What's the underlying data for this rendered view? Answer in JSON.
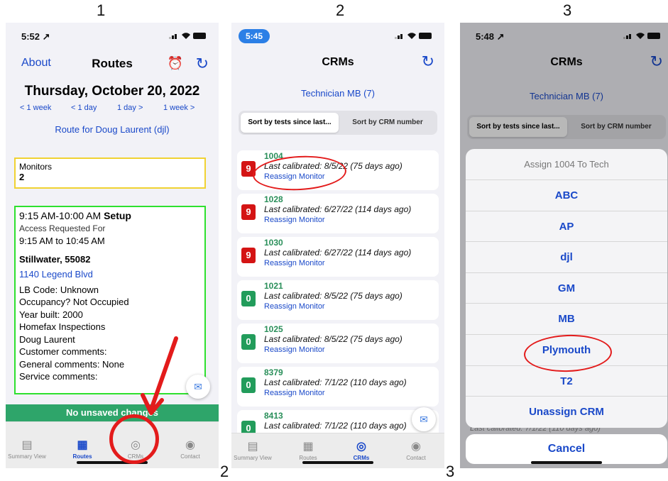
{
  "panel_numbers": [
    "1",
    "2",
    "3"
  ],
  "bottom_labels": [
    "2",
    "3"
  ],
  "colors": {
    "accent": "#1a49c9",
    "green_bar": "#2ea56a",
    "red_badge": "#d41414",
    "green_badge": "#229c5b",
    "annotation_red": "#e31b1b"
  },
  "panel1": {
    "status_time": "5:52 ↗",
    "nav": {
      "about": "About",
      "title": "Routes",
      "alarm_icon": "⏰",
      "refresh_icon": "↻"
    },
    "date": "Thursday, October 20, 2022",
    "nudges": [
      "< 1 week",
      "< 1 day",
      "1 day >",
      "1 week >"
    ],
    "route": "Route for Doug Laurent (djl)",
    "monitors": {
      "label": "Monitors",
      "value": "2"
    },
    "appointment": {
      "time": "9:15 AM-10:00 AM",
      "type": "Setup",
      "access_label": "Access Requested For",
      "access_time": "9:15 AM to 10:45 AM",
      "city": "Stillwater, 55082",
      "address": "1140 Legend Blvd",
      "lines": [
        "LB Code: Unknown",
        "Occupancy? Not Occupied",
        "Year built: 2000",
        "Homefax Inspections",
        "Doug Laurent",
        "Customer comments:",
        "General comments: None",
        "Service comments:"
      ]
    },
    "save_bar": "No unsaved changes",
    "tabs": [
      "Summary View",
      "Routes",
      "CRMs",
      "Contact"
    ]
  },
  "panel2": {
    "status_time": "5:45",
    "title": "CRMs",
    "technician": "Technician MB (7)",
    "seg": [
      "Sort by tests since last...",
      "Sort by CRM number"
    ],
    "rows": [
      {
        "badge": "9",
        "num": "1004",
        "cal": "Last calibrated: 8/5/22 (75 days ago)",
        "action": "Reassign Monitor"
      },
      {
        "badge": "9",
        "num": "1028",
        "cal": "Last calibrated: 6/27/22 (114 days ago)",
        "action": "Reassign Monitor"
      },
      {
        "badge": "9",
        "num": "1030",
        "cal": "Last calibrated: 6/27/22 (114 days ago)",
        "action": "Reassign Monitor"
      },
      {
        "badge": "0",
        "num": "1021",
        "cal": "Last calibrated: 8/5/22 (75 days ago)",
        "action": "Reassign Monitor"
      },
      {
        "badge": "0",
        "num": "1025",
        "cal": "Last calibrated: 8/5/22 (75 days ago)",
        "action": "Reassign Monitor"
      },
      {
        "badge": "0",
        "num": "8379",
        "cal": "Last calibrated: 7/1/22 (110 days ago)",
        "action": "Reassign Monitor"
      },
      {
        "badge": "0",
        "num": "8413",
        "cal": "Last calibrated: 7/1/22 (110 days ago)",
        "action": ""
      }
    ],
    "tabs": [
      "Summary View",
      "Routes",
      "CRMs",
      "Contact"
    ]
  },
  "panel3": {
    "status_time": "5:48 ↗",
    "title": "CRMs",
    "technician": "Technician MB (7)",
    "seg": [
      "Sort by tests since last...",
      "Sort by CRM number"
    ],
    "sheet_title": "Assign 1004 To Tech",
    "options": [
      "ABC",
      "AP",
      "djl",
      "GM",
      "MB",
      "Plymouth",
      "T2",
      "Unassign CRM"
    ],
    "peek": "Last calibrated: 7/1/22 (110 days ago)",
    "cancel": "Cancel"
  }
}
